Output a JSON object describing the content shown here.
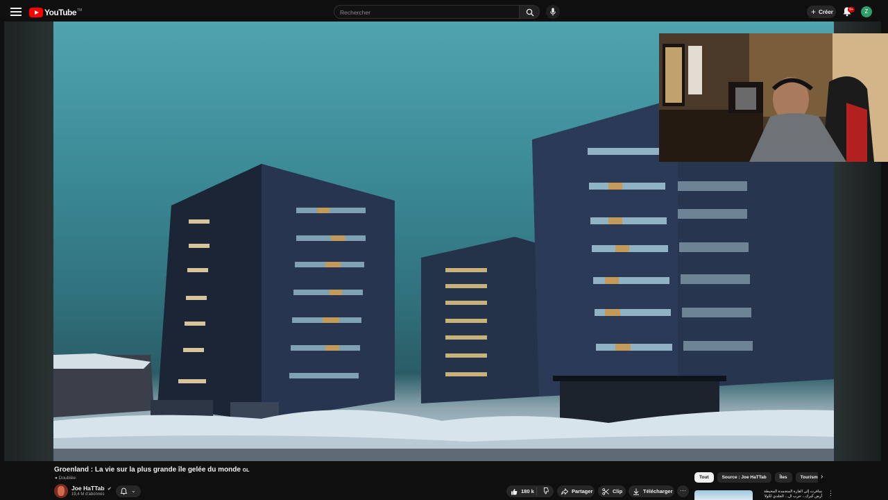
{
  "header": {
    "logo_text": "YouTube",
    "logo_tm": "TM",
    "search_placeholder": "Rechercher",
    "create_label": "Créer",
    "notification_count": "9+",
    "account_initial": "Z"
  },
  "video": {
    "title": "Groenland : La vie sur la plus grande île gelée du monde",
    "flag_code": "GL",
    "dubbed_label": "Doublée"
  },
  "channel": {
    "name": "Joe HaTTab",
    "subscribers": "19,4 M d'abonnés"
  },
  "actions": {
    "like_count": "180 k",
    "share_label": "Partager",
    "clip_label": "Clip",
    "download_label": "Télécharger",
    "more_label": "⋯"
  },
  "chips": {
    "items": [
      "Tout",
      "Source : Joe HaTTab",
      "Îles",
      "Tourisme"
    ]
  },
  "recommendation": {
    "title": "سافرت إلى القارة المتجمدة المحيطة أرض كبرك... حرب ال... الجلدي لكولا"
  },
  "icons": {
    "menu": "menu-icon",
    "search": "search-icon",
    "mic": "mic-icon",
    "bell": "bell-icon",
    "like": "thumbs-up-icon",
    "dislike": "thumbs-down-icon",
    "share": "share-icon",
    "clip": "scissors-icon",
    "download": "download-icon"
  },
  "colors": {
    "background": "#0f0f0f",
    "brand_red": "#ff0000",
    "badge_red": "#cc0000",
    "avatar_green": "#2e9e6b",
    "chip_bg": "#272727"
  }
}
